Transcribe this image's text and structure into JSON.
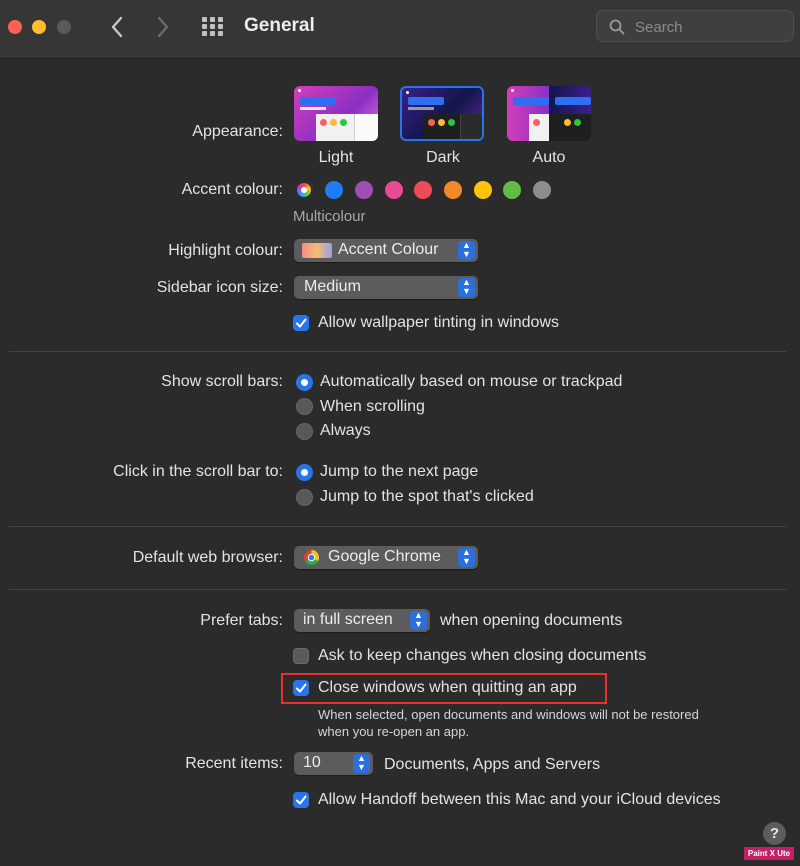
{
  "window": {
    "title": "General",
    "search_placeholder": "Search",
    "colors": {
      "close": "#fe5f57",
      "minimize": "#febc2e",
      "zoom": "#5a5a5a"
    }
  },
  "appearance": {
    "label": "Appearance:",
    "options": [
      "Light",
      "Dark",
      "Auto"
    ],
    "selected": "Dark"
  },
  "accent": {
    "label": "Accent colour:",
    "selected_name": "Multicolour",
    "swatches": [
      "#1e7cf6",
      "#9d4fb5",
      "#e84a94",
      "#ed4c55",
      "#f3892b",
      "#fdc30d",
      "#63ba47",
      "#8d8d8d"
    ]
  },
  "highlight": {
    "label": "Highlight colour:",
    "value": "Accent Colour"
  },
  "sidebar_icon": {
    "label": "Sidebar icon size:",
    "value": "Medium"
  },
  "wallpaper_tinting": {
    "label": "Allow wallpaper tinting in windows",
    "checked": true
  },
  "scroll_bars": {
    "label": "Show scroll bars:",
    "options": [
      "Automatically based on mouse or trackpad",
      "When scrolling",
      "Always"
    ],
    "selected": 0
  },
  "click_scroll": {
    "label": "Click in the scroll bar to:",
    "options": [
      "Jump to the next page",
      "Jump to the spot that's clicked"
    ],
    "selected": 0
  },
  "browser": {
    "label": "Default web browser:",
    "value": "Google Chrome"
  },
  "tabs": {
    "label": "Prefer tabs:",
    "value": "in full screen",
    "suffix": "when opening documents"
  },
  "ask_keep": {
    "label": "Ask to keep changes when closing documents",
    "checked": false
  },
  "close_windows": {
    "label": "Close windows when quitting an app",
    "checked": true,
    "note_line1": "When selected, open documents and windows will not be restored",
    "note_line2": "when you re-open an app."
  },
  "recent": {
    "label": "Recent items:",
    "value": "10",
    "suffix": "Documents, Apps and Servers"
  },
  "handoff": {
    "label": "Allow Handoff between this Mac and your iCloud devices",
    "checked": true
  },
  "help": "?",
  "watermark": "Paint X Ute"
}
